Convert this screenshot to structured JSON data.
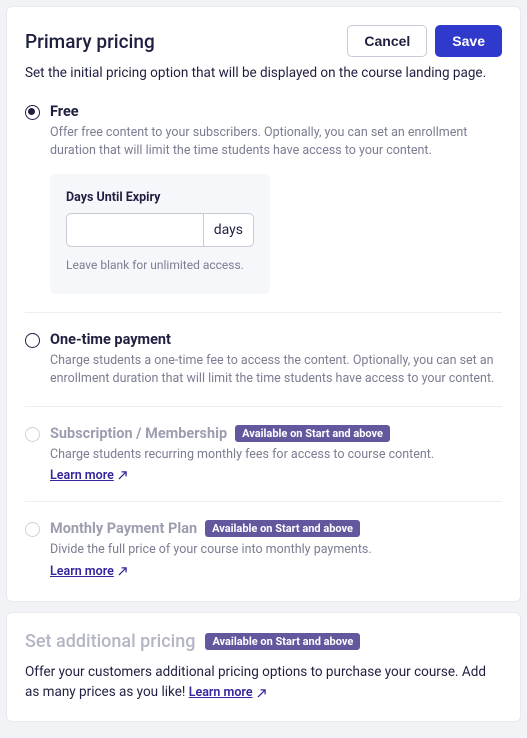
{
  "header": {
    "title": "Primary pricing",
    "cancel": "Cancel",
    "save": "Save"
  },
  "subtitle": "Set the initial pricing option that will be displayed on the course landing page.",
  "options": {
    "free": {
      "title": "Free",
      "desc": "Offer free content to your subscribers. Optionally, you can set an enrollment duration that will limit the time students have access to your content.",
      "expiry": {
        "label": "Days Until Expiry",
        "suffix": "days",
        "hint": "Leave blank for unlimited access."
      }
    },
    "onetime": {
      "title": "One-time payment",
      "desc": "Charge students a one-time fee to access the content. Optionally, you can set an enrollment duration that will limit the time students have access to your content."
    },
    "subscription": {
      "title": "Subscription / Membership",
      "badge": "Available on Start and above",
      "desc": "Charge students recurring monthly fees for access to course content.",
      "learn": "Learn more"
    },
    "monthly": {
      "title": "Monthly Payment Plan",
      "badge": "Available on Start and above",
      "desc": "Divide the full price of your course into monthly payments.",
      "learn": "Learn more"
    }
  },
  "additional": {
    "title": "Set additional pricing",
    "badge": "Available on Start and above",
    "desc_prefix": "Offer your customers additional pricing options to purchase your course. Add as many prices as you like! ",
    "learn": "Learn more"
  }
}
